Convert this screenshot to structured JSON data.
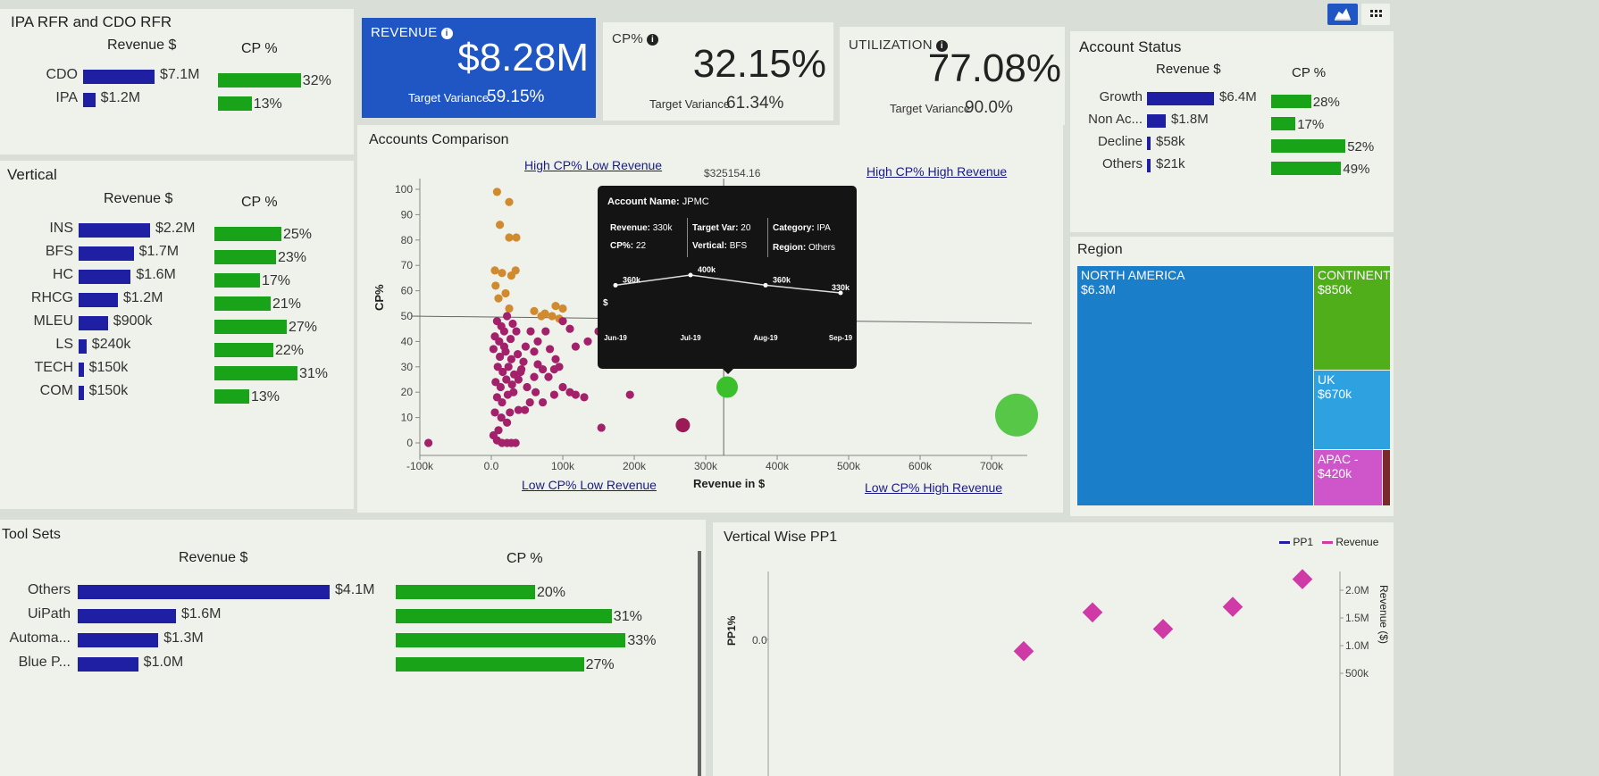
{
  "ipa_cdo": {
    "title": "IPA RFR and CDO RFR",
    "rev_header": "Revenue $",
    "cp_header": "CP %",
    "rows": [
      {
        "label": "CDO",
        "revenue": "$7.1M",
        "cp": "32%",
        "rev_frac": 1.0,
        "cp_frac": 0.32
      },
      {
        "label": "IPA",
        "revenue": "$1.2M",
        "cp": "13%",
        "rev_frac": 0.17,
        "cp_frac": 0.13
      }
    ]
  },
  "vertical": {
    "title": "Vertical",
    "rev_header": "Revenue $",
    "cp_header": "CP %",
    "rows": [
      {
        "label": "INS",
        "revenue": "$2.2M",
        "cp": "25%",
        "rev_frac": 1.0,
        "cp_frac": 0.25
      },
      {
        "label": "BFS",
        "revenue": "$1.7M",
        "cp": "23%",
        "rev_frac": 0.77,
        "cp_frac": 0.23
      },
      {
        "label": "HC",
        "revenue": "$1.6M",
        "cp": "17%",
        "rev_frac": 0.73,
        "cp_frac": 0.17
      },
      {
        "label": "RHCG",
        "revenue": "$1.2M",
        "cp": "21%",
        "rev_frac": 0.55,
        "cp_frac": 0.21
      },
      {
        "label": "MLEU",
        "revenue": "$900k",
        "cp": "27%",
        "rev_frac": 0.41,
        "cp_frac": 0.27
      },
      {
        "label": "LS",
        "revenue": "$240k",
        "cp": "22%",
        "rev_frac": 0.11,
        "cp_frac": 0.22
      },
      {
        "label": "TECH",
        "revenue": "$150k",
        "cp": "31%",
        "rev_frac": 0.07,
        "cp_frac": 0.31
      },
      {
        "label": "COM",
        "revenue": "$150k",
        "cp": "13%",
        "rev_frac": 0.07,
        "cp_frac": 0.13
      }
    ]
  },
  "kpi": {
    "revenue": {
      "title": "REVENUE",
      "value": "$8.28M",
      "sub_label": "Target Variance",
      "sub_value": "59.15%"
    },
    "cp": {
      "title": "CP%",
      "value": "32.15%",
      "sub_label": "Target Variance",
      "sub_value": "61.34%"
    },
    "util": {
      "title": "UTILIZATION",
      "value": "77.08%",
      "sub_label": "Target Variance",
      "sub_value": "90.0%"
    }
  },
  "account_status": {
    "title": "Account Status",
    "rev_header": "Revenue $",
    "cp_header": "CP %",
    "rows": [
      {
        "label": "Growth",
        "revenue": "$6.4M",
        "cp": "28%",
        "rev_frac": 1.0,
        "cp_frac": 0.28
      },
      {
        "label": "Non Ac...",
        "revenue": "$1.8M",
        "cp": "17%",
        "rev_frac": 0.28,
        "cp_frac": 0.17
      },
      {
        "label": "Decline",
        "revenue": "$58k",
        "cp": "52%",
        "rev_frac": 0.0,
        "cp_frac": 0.52
      },
      {
        "label": "Others",
        "revenue": "$21k",
        "cp": "49%",
        "rev_frac": 0.0,
        "cp_frac": 0.49
      }
    ]
  },
  "comparison": {
    "title": "Accounts Comparison",
    "q_tl": "High CP% Low Revenue",
    "q_tr": "High CP% High Revenue",
    "q_bl": "Low CP% Low Revenue",
    "q_br": "Low CP% High Revenue",
    "ref_label": "$325154.16",
    "tooltip": {
      "account_label": "Account Name:",
      "account": "JPMC",
      "revenue_label": "Revenue:",
      "revenue": "330k",
      "cp_label": "CP%:",
      "cp": "22",
      "target_label": "Target Var:",
      "target": "20",
      "vertical_label": "Vertical:",
      "vertical": "BFS",
      "category_label": "Category:",
      "category": "IPA",
      "region_label": "Region:",
      "region": "Others",
      "trend_months": [
        "Jun-19",
        "Jul-19",
        "Aug-19",
        "Sep-19"
      ],
      "trend_labels": [
        "360k",
        "400k",
        "360k",
        "330k"
      ],
      "trend_values": [
        360,
        400,
        360,
        330
      ],
      "axis_symbol": "$"
    }
  },
  "chart_data": {
    "type": "scatter",
    "xlabel": "Revenue in $",
    "ylabel": "CP%",
    "xlim": [
      -100000,
      750000
    ],
    "ylim": [
      0,
      100
    ],
    "x_ticks": [
      "-100k",
      "0.0",
      "100k",
      "200k",
      "300k",
      "400k",
      "500k",
      "600k",
      "700k"
    ],
    "y_ticks": [
      "0",
      "10",
      "20",
      "30",
      "40",
      "50",
      "60",
      "70",
      "80",
      "90",
      "100"
    ],
    "ref_x": 325154.16,
    "ref_y": 50,
    "series": [
      {
        "color": "#d08a30",
        "points": [
          [
            8000,
            99
          ],
          [
            25000,
            95
          ],
          [
            12000,
            86
          ],
          [
            25000,
            81
          ],
          [
            35000,
            81
          ],
          [
            5000,
            68
          ],
          [
            15000,
            67
          ],
          [
            28000,
            66
          ],
          [
            34000,
            68
          ],
          [
            6000,
            62
          ],
          [
            20000,
            59
          ],
          [
            10000,
            57
          ],
          [
            25000,
            53
          ],
          [
            60000,
            52
          ],
          [
            70000,
            50
          ],
          [
            85000,
            50
          ],
          [
            100000,
            53
          ],
          [
            95000,
            49
          ],
          [
            75000,
            51
          ],
          [
            90000,
            54
          ]
        ]
      },
      {
        "color": "#a3206a",
        "points": [
          [
            8000,
            48
          ],
          [
            14000,
            46
          ],
          [
            22000,
            50
          ],
          [
            30000,
            47
          ],
          [
            5000,
            42
          ],
          [
            11000,
            40
          ],
          [
            18000,
            44
          ],
          [
            27000,
            41
          ],
          [
            35000,
            44
          ],
          [
            3000,
            37
          ],
          [
            12000,
            34
          ],
          [
            20000,
            36
          ],
          [
            28000,
            33
          ],
          [
            37000,
            35
          ],
          [
            45000,
            32
          ],
          [
            9000,
            30
          ],
          [
            16000,
            28
          ],
          [
            24000,
            30
          ],
          [
            32000,
            27
          ],
          [
            41000,
            28
          ],
          [
            6000,
            24
          ],
          [
            13000,
            22
          ],
          [
            21000,
            25
          ],
          [
            29000,
            23
          ],
          [
            38000,
            25
          ],
          [
            50000,
            22
          ],
          [
            8000,
            18
          ],
          [
            15000,
            16
          ],
          [
            23000,
            19
          ],
          [
            31000,
            20
          ],
          [
            47000,
            13
          ],
          [
            54000,
            16
          ],
          [
            5000,
            12
          ],
          [
            14000,
            10
          ],
          [
            22000,
            8
          ],
          [
            3000,
            3
          ],
          [
            8000,
            1
          ],
          [
            15000,
            0
          ],
          [
            22000,
            0
          ],
          [
            28000,
            0
          ],
          [
            34000,
            0
          ],
          [
            60000,
            26
          ],
          [
            65000,
            31
          ],
          [
            72000,
            29
          ],
          [
            80000,
            26
          ],
          [
            88000,
            29
          ],
          [
            95000,
            30
          ],
          [
            62000,
            20
          ],
          [
            72000,
            16
          ],
          [
            88000,
            19
          ],
          [
            100000,
            22
          ],
          [
            100000,
            48
          ],
          [
            110000,
            45
          ],
          [
            118000,
            38
          ],
          [
            76000,
            44
          ],
          [
            65000,
            40
          ],
          [
            82000,
            37
          ],
          [
            90000,
            33
          ],
          [
            110000,
            20
          ],
          [
            118000,
            19
          ],
          [
            130000,
            18
          ],
          [
            154000,
            6
          ],
          [
            194000,
            19
          ],
          [
            -88000,
            0
          ],
          [
            135000,
            40
          ],
          [
            150000,
            44
          ],
          [
            60000,
            36
          ],
          [
            48000,
            38
          ],
          [
            55000,
            44
          ],
          [
            42000,
            29
          ],
          [
            38000,
            13
          ],
          [
            26000,
            12
          ],
          [
            18000,
            38
          ],
          [
            10000,
            5
          ]
        ]
      },
      {
        "color": "#9c1a55",
        "points": [
          [
            268000,
            7
          ]
        ],
        "size": 8
      },
      {
        "color": "#3cbf2c",
        "points": [
          [
            330000,
            22
          ]
        ],
        "size": 12
      },
      {
        "color": "#3cbf2c",
        "points": [
          [
            735000,
            11
          ]
        ],
        "size": 24
      }
    ]
  },
  "account_status_icons": {
    "chart_view": "area-chart-icon",
    "grid_view": "grid-icon"
  },
  "region": {
    "title": "Region",
    "cells": [
      {
        "name": "NORTH AMERICA",
        "value": "$6.3M",
        "color": "#1a7ec8"
      },
      {
        "name": "CONTINENTAL",
        "value": "$850k",
        "color": "#4fae1a"
      },
      {
        "name": "UK",
        "value": "$670k",
        "color": "#2ea2e0"
      },
      {
        "name": "APAC -",
        "value": "$420k",
        "color": "#cf55cb"
      }
    ]
  },
  "toolsets": {
    "title": "Tool Sets",
    "rev_header": "Revenue $",
    "cp_header": "CP %",
    "rows": [
      {
        "label": "Others",
        "revenue": "$4.1M",
        "cp": "20%",
        "rev_frac": 1.0,
        "cp_frac": 0.2
      },
      {
        "label": "UiPath",
        "revenue": "$1.6M",
        "cp": "31%",
        "rev_frac": 0.39,
        "cp_frac": 0.31
      },
      {
        "label": "Automa...",
        "revenue": "$1.3M",
        "cp": "33%",
        "rev_frac": 0.32,
        "cp_frac": 0.33
      },
      {
        "label": "Blue P...",
        "revenue": "$1.0M",
        "cp": "27%",
        "rev_frac": 0.24,
        "cp_frac": 0.27
      }
    ]
  },
  "vertical_pp1": {
    "title": "Vertical Wise PP1",
    "legend": [
      {
        "name": "PP1",
        "color": "#1f1fa3"
      },
      {
        "name": "Revenue",
        "color": "#cf3aa6"
      }
    ],
    "ylabel_left": "PP1%",
    "ylabel_right": "Revenue ($)",
    "left_tick": "0.0",
    "right_ticks": [
      "2.0M",
      "1.5M",
      "1.0M",
      "500k"
    ],
    "revenue_values": [
      0.9,
      1.6,
      1.3,
      1.7,
      2.2
    ]
  }
}
